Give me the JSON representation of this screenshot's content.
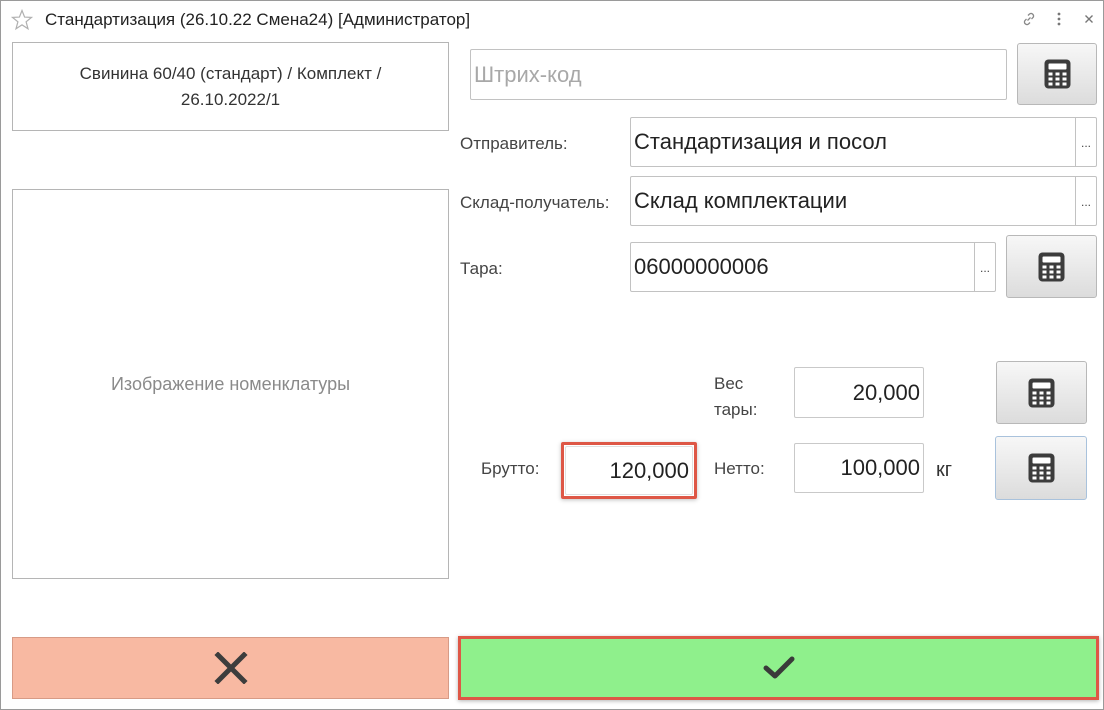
{
  "window": {
    "title": "Стандартизация (26.10.22 Смена24) [Администратор]",
    "icons": [
      "star-icon",
      "link-icon",
      "more-icon",
      "close-icon"
    ]
  },
  "product": {
    "line1": "Свинина 60/40 (стандарт) / Комплект /",
    "line2": "26.10.2022/1"
  },
  "image_placeholder": "Изображение номенклатуры",
  "barcode": {
    "placeholder": "Штрих-код",
    "value": ""
  },
  "sender": {
    "label": "Отправитель:",
    "value": "Стандартизация и посол",
    "select_label": "..."
  },
  "warehouse": {
    "label": "Склад-получатель:",
    "value": "Склад комплектации",
    "select_label": "..."
  },
  "tare": {
    "label": "Тара:",
    "value": "06000000006",
    "select_label": "..."
  },
  "tare_weight": {
    "label_line1": "Вес",
    "label_line2": "тары:",
    "value": "20,000"
  },
  "gross": {
    "label": "Брутто:",
    "value": "120,000"
  },
  "net": {
    "label": "Нетто:",
    "value": "100,000",
    "unit": "кг"
  },
  "buttons": {
    "cancel_icon": "close-icon",
    "ok_icon": "checkmark-icon",
    "calculator_icon": "calculator-icon"
  },
  "colors": {
    "cancel_bg": "#f8b9a2",
    "ok_bg": "#8ff08c",
    "highlight": "#de5746"
  }
}
